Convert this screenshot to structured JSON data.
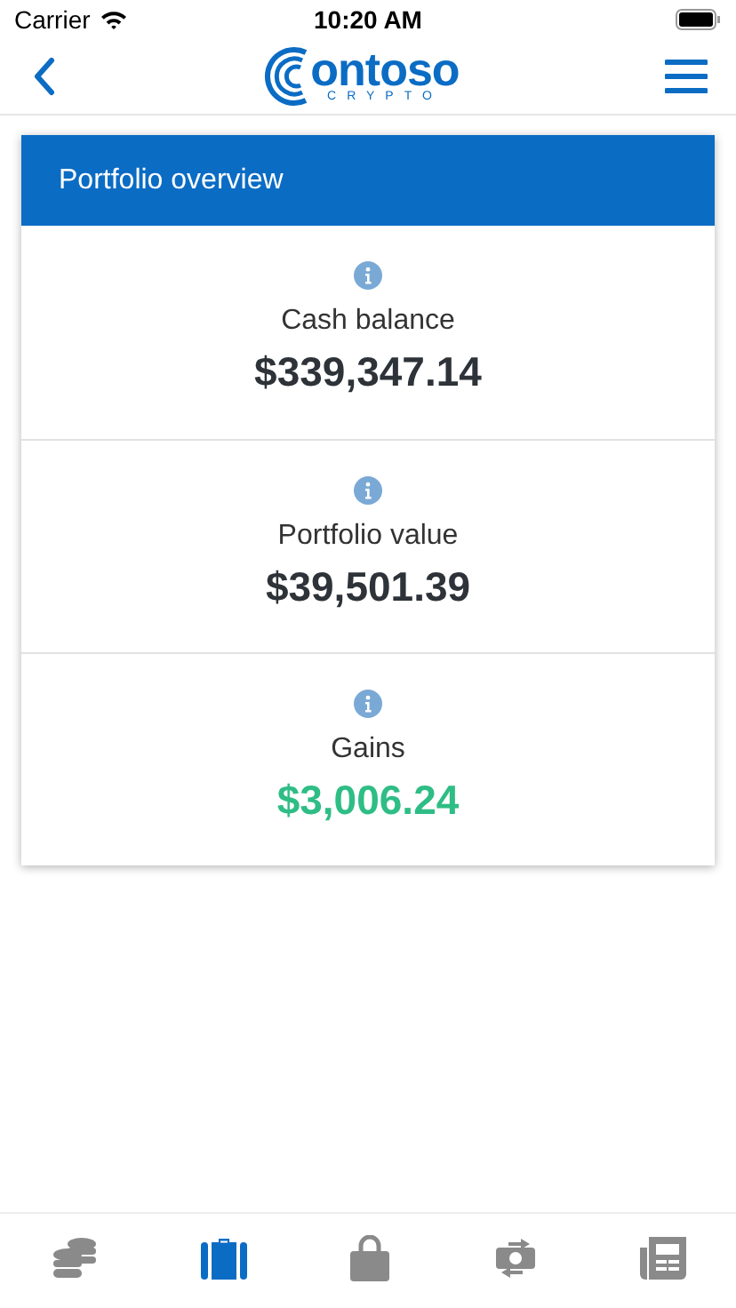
{
  "status_bar": {
    "carrier": "Carrier",
    "time": "10:20 AM"
  },
  "header": {
    "logo_text": "ontoso",
    "logo_subtext": "CRYPTO"
  },
  "card": {
    "title": "Portfolio overview",
    "metrics": [
      {
        "label": "Cash balance",
        "value": "$339,347.14",
        "color": "#2d3338"
      },
      {
        "label": "Portfolio value",
        "value": "$39,501.39",
        "color": "#2d3338"
      },
      {
        "label": "Gains",
        "value": "$3,006.24",
        "color": "#2ebd85"
      }
    ]
  },
  "tab_bar": [
    {
      "kind": "coins",
      "selected": false
    },
    {
      "kind": "briefcase",
      "selected": true
    },
    {
      "kind": "bag",
      "selected": false
    },
    {
      "kind": "exchange",
      "selected": false
    },
    {
      "kind": "news",
      "selected": false
    }
  ]
}
